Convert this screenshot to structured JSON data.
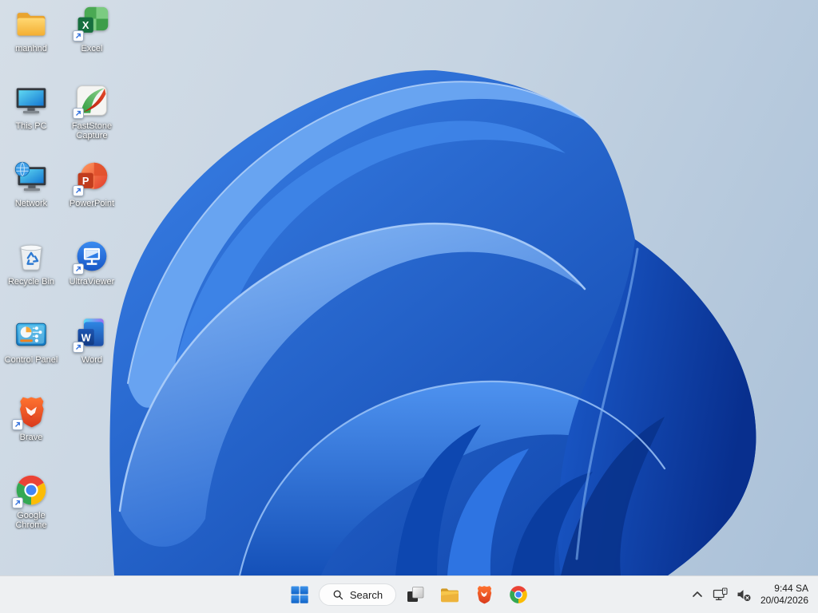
{
  "desktop": {
    "icons": [
      {
        "label": "manhnd",
        "icon": "folder-icon",
        "shortcut": false
      },
      {
        "label": "Excel",
        "icon": "excel-icon",
        "shortcut": true
      },
      {
        "label": "This PC",
        "icon": "this-pc-icon",
        "shortcut": false
      },
      {
        "label": "FastStone Capture",
        "icon": "faststone-capture-icon",
        "shortcut": true
      },
      {
        "label": "Network",
        "icon": "network-icon",
        "shortcut": false
      },
      {
        "label": "PowerPoint",
        "icon": "powerpoint-icon",
        "shortcut": true
      },
      {
        "label": "Recycle Bin",
        "icon": "recycle-bin-icon",
        "shortcut": false
      },
      {
        "label": "UltraViewer",
        "icon": "ultraviewer-icon",
        "shortcut": true
      },
      {
        "label": "Control Panel",
        "icon": "control-panel-icon",
        "shortcut": false
      },
      {
        "label": "Word",
        "icon": "word-icon",
        "shortcut": true
      },
      {
        "label": "Brave",
        "icon": "brave-icon",
        "shortcut": true
      },
      {
        "label": "Google Chrome",
        "icon": "chrome-icon",
        "shortcut": true
      }
    ],
    "logo_letters": {
      "excel": "X",
      "powerpoint": "P",
      "word": "W"
    }
  },
  "taskbar": {
    "search_label": "Search",
    "buttons": [
      {
        "name": "start"
      },
      {
        "name": "search"
      },
      {
        "name": "task-view"
      },
      {
        "name": "file-explorer"
      },
      {
        "name": "brave"
      },
      {
        "name": "chrome"
      }
    ],
    "tray": {
      "icons": [
        {
          "name": "hidden-icons-chevron"
        },
        {
          "name": "network"
        },
        {
          "name": "volume-muted"
        }
      ],
      "time": "9:44 SA",
      "date": "20/04/2026"
    }
  },
  "colors": {
    "desktop_bg_top": "#d5dee7",
    "desktop_bg_bottom": "#a9c0d8",
    "bloom_primary": "#2d74e0",
    "bloom_dark": "#0a3fa4",
    "bloom_highlight": "#aecff9",
    "taskbar_bg": "#eef0f2",
    "taskbar_border": "#d8dadc",
    "search_pill_bg": "#fdfdfd",
    "search_pill_border": "#dcdfe2",
    "search_text": "#1f1f1f",
    "tray_icon": "#3a3a3a",
    "clock_text": "#1b1b1b",
    "icon_label": "#ffffff",
    "windows_blue": "#1873d3"
  }
}
